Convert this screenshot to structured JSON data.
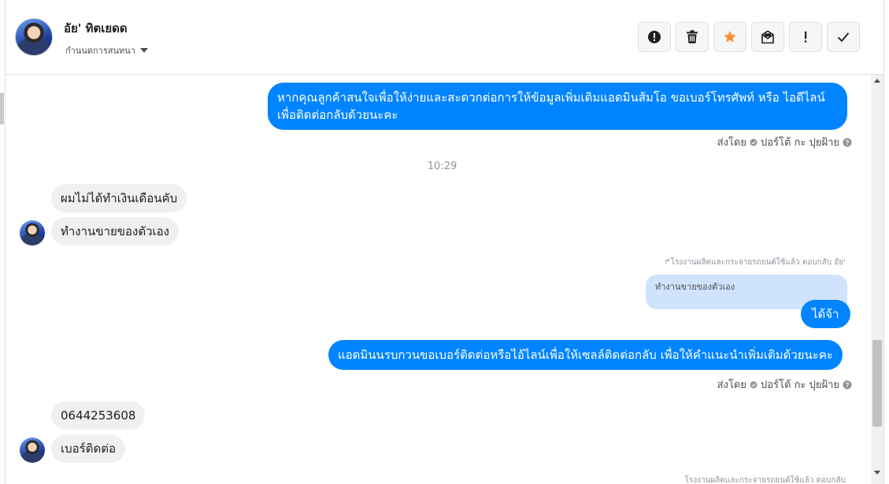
{
  "header": {
    "contact_name": "อัย' ทิตเยดด",
    "sub_label": "กำนนดการสนทนา",
    "actions": [
      {
        "name": "report-button",
        "icon": "exclamation-circle-icon"
      },
      {
        "name": "delete-button",
        "icon": "trash-icon"
      },
      {
        "name": "star-button",
        "icon": "star-icon"
      },
      {
        "name": "mark-unread-button",
        "icon": "envelope-icon"
      },
      {
        "name": "important-button",
        "icon": "exclamation-icon"
      },
      {
        "name": "done-button",
        "icon": "checkmark-icon"
      }
    ],
    "colors": {
      "star": "#f7923a",
      "accent": "#0084ff"
    }
  },
  "messages": {
    "out1": "หากคุณลูกค้าสนใจเพื่อให้ง่ายและสะดวกต่อการให้ข้อมูลเพิ่มเติมแอดมินส้มโอ ขอเบอร์โทรศัพท์ หรือ ไอดีไลน์ เพื่อติดต่อกลับด้วยนะคะ",
    "meta1_prefix": "ส่งโดย",
    "meta1_name": "ปอร์โต้ กะ ปุยฝ้าย",
    "timestamp": "10:29",
    "in1": "ผมไม่ได้ทำเงินเดือนคับ",
    "in2": "ทำงานขายของตัวเอง",
    "reply_note": "โรงงานผลิตและกระจายรถยนต์ใช้แล้ว ตอบกลับ อัย'",
    "reply_quote": "ทำงานขายของตัวเอง",
    "out2": "ได้จ้า",
    "out3": "แอดมินนรบกวนขอเบอร์ติดต่อหรือไอ้ไลน์เพื่อให้เซลล์ติดต่อกลับ เพื่อให้คำแนะนำเพิ่มเติมด้วยนะคะ",
    "meta2_prefix": "ส่งโดย",
    "meta2_name": "ปอร์โต้ กะ ปุยฝ้าย",
    "in3": "0644253608",
    "in4": "เบอร์ติดต่อ",
    "cut_note": "โรงงานผลิตและกระจายรถยนต์ใช้แล้ว ตอบกลับ"
  }
}
